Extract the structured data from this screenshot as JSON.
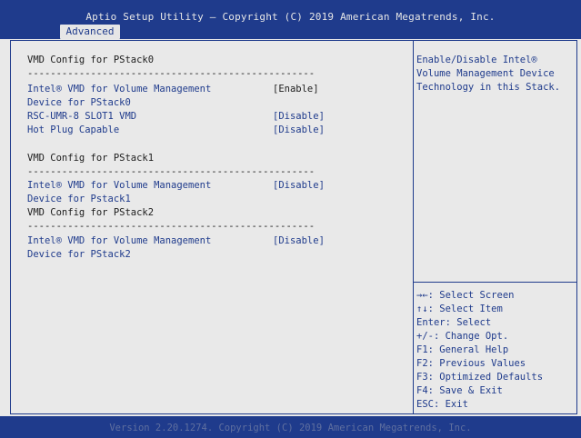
{
  "header": {
    "title": "Aptio Setup Utility – Copyright (C) 2019 American Megatrends, Inc.",
    "tab": "Advanced"
  },
  "main": {
    "pstack0_header": "VMD Config for PStack0",
    "separator": "--------------------------------------------------",
    "pstack0_vmd_label_line1": "Intel® VMD for Volume Management",
    "pstack0_vmd_label_line2": "Device for PStack0",
    "pstack0_vmd_value": "[Enable]",
    "rsc_label": "RSC-UMR-8 SLOT1 VMD",
    "rsc_value": "[Disable]",
    "hotplug_label": "Hot Plug Capable",
    "hotplug_value": "[Disable]",
    "pstack1_header": "VMD Config for PStack1",
    "pstack1_vmd_label_line1": "Intel® VMD for Volume Management",
    "pstack1_vmd_label_line2": "Device for Pstack1",
    "pstack1_vmd_value": "[Disable]",
    "pstack2_header": "VMD Config for PStack2",
    "pstack2_vmd_label_line1": "Intel® VMD for Volume Management",
    "pstack2_vmd_label_line2": "Device for PStack2",
    "pstack2_vmd_value": "[Disable]"
  },
  "help": {
    "line1": "Enable/Disable Intel®",
    "line2": "Volume Management Device",
    "line3": "Technology in this Stack."
  },
  "keys": [
    "→←: Select Screen",
    "↑↓: Select Item",
    "Enter: Select",
    "+/-: Change Opt.",
    "F1: General Help",
    "F2: Previous Values",
    "F3: Optimized Defaults",
    "F4: Save & Exit",
    "ESC: Exit"
  ],
  "footer": {
    "version": "Version 2.20.1274. Copyright (C) 2019 American Megatrends, Inc."
  },
  "colors": {
    "bar": "#1f3b8c",
    "background": "#e9e9e9",
    "text": "#1d1d1d",
    "highlight": "#1f3b8c"
  }
}
